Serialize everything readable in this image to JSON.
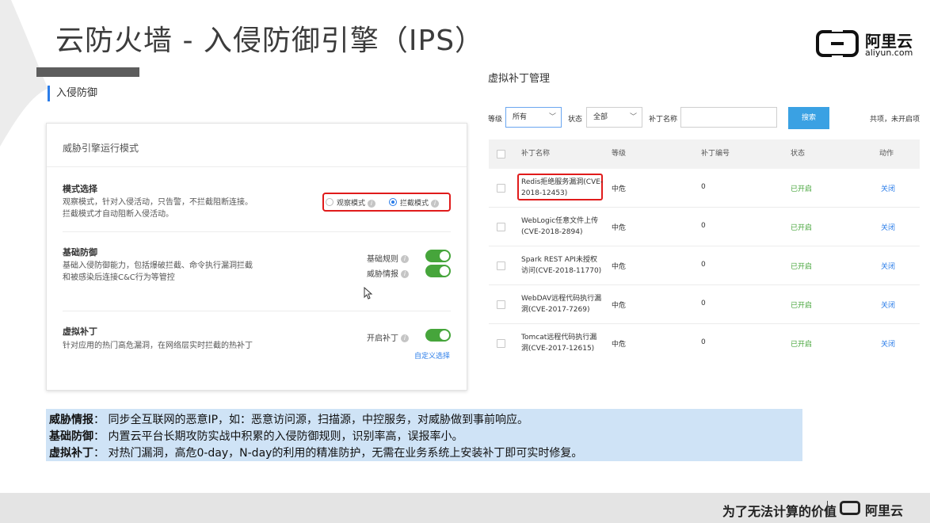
{
  "slide": {
    "title": "云防火墙 - 入侵防御引擎（IPS）",
    "logo_cn": "阿里云",
    "logo_en": "aliyun.com"
  },
  "left": {
    "section_title": "入侵防御",
    "panel_title": "威胁引擎运行模式",
    "mode": {
      "title": "模式选择",
      "desc_line1": "观察模式，针对入侵活动，只告警，不拦截阻断连接。",
      "desc_line2": "拦截模式才自动阻断入侵活动。",
      "option_observe": "观察模式",
      "option_block": "拦截模式",
      "selected": "拦截模式"
    },
    "basic": {
      "title": "基础防御",
      "desc_line1": "基础入侵防御能力，包括爆破拦截、命令执行漏洞拦截",
      "desc_line2": "和被感染后连接C&C行为等管控",
      "toggle1_label": "基础规则",
      "toggle2_label": "威胁情报"
    },
    "patch": {
      "title": "虚拟补丁",
      "desc": "针对应用的热门高危漏洞，在网络层实时拦截的热补丁",
      "toggle_label": "开启补丁",
      "custom_link": "自定义选择"
    }
  },
  "right": {
    "title": "虚拟补丁管理",
    "filters": {
      "level_label": "等级",
      "level_value": "所有",
      "status_label": "状态",
      "status_value": "全部",
      "name_label": "补丁名称",
      "name_value": "",
      "search_button": "搜索",
      "total_text": "共项，未开启项"
    },
    "table": {
      "headers": [
        "补丁名称",
        "等级",
        "补丁编号",
        "状态",
        "动作"
      ],
      "rows": [
        {
          "name": "Redis拒绝服务漏洞(CVE-2018-12453)",
          "level": "中危",
          "number": "0",
          "status": "已开启",
          "action": "关闭"
        },
        {
          "name": "WebLogic任意文件上传(CVE-2018-2894)",
          "level": "中危",
          "number": "0",
          "status": "已开启",
          "action": "关闭"
        },
        {
          "name": "Spark REST API未授权访问(CVE-2018-11770)",
          "level": "中危",
          "number": "0",
          "status": "已开启",
          "action": "关闭"
        },
        {
          "name": "WebDAV远程代码执行漏洞(CVE-2017-7269)",
          "level": "中危",
          "number": "0",
          "status": "已开启",
          "action": "关闭"
        },
        {
          "name": "Tomcat远程代码执行漏洞(CVE-2017-12615)",
          "level": "中危",
          "number": "0",
          "status": "已开启",
          "action": "关闭"
        }
      ]
    }
  },
  "notes": [
    {
      "term": "威胁情报",
      "text": "：  同步全互联网的恶意IP，如：恶意访问源，扫描源，中控服务，对威胁做到事前响应。"
    },
    {
      "term": "基础防御",
      "text": "：  内置云平台长期攻防实战中积累的入侵防御规则，识别率高，误报率小。"
    },
    {
      "term": "虚拟补丁",
      "text": "：  对热门漏洞，高危0-day，N-day的利用的精准防护，无需在业务系统上安装补丁即可实时修复。"
    }
  ],
  "footer": {
    "slogan": "为了无法计算的价值",
    "logo": "阿里云"
  },
  "colors": {
    "accent": "#2b7de9",
    "toggle_on": "#46a53b",
    "highlight_box": "#e01b1b",
    "note_bg": "#cfe3f6"
  }
}
